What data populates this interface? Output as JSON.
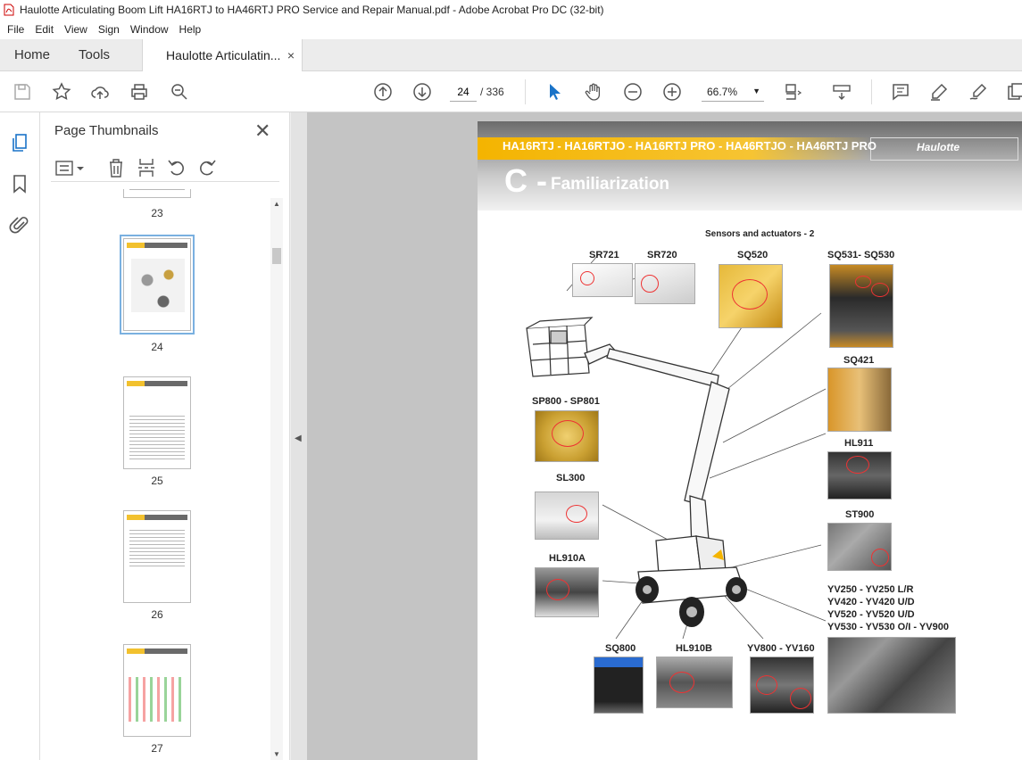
{
  "window": {
    "title": "Haulotte Articulating Boom Lift HA16RTJ to HA46RTJ PRO Service and Repair Manual.pdf - Adobe Acrobat Pro DC (32-bit)"
  },
  "menu": [
    "File",
    "Edit",
    "View",
    "Sign",
    "Window",
    "Help"
  ],
  "tabs": {
    "home": "Home",
    "tools": "Tools",
    "doc": "Haulotte Articulatin...",
    "close": "×"
  },
  "toolbar": {
    "page_current": "24",
    "page_total": "/ 336",
    "zoom": "66.7%"
  },
  "thumbnails": {
    "title": "Page Thumbnails",
    "pages": [
      {
        "label": "23"
      },
      {
        "label": "24",
        "selected": true
      },
      {
        "label": "25"
      },
      {
        "label": "26"
      },
      {
        "label": "27"
      }
    ]
  },
  "page": {
    "models": "HA16RTJ - HA16RTJO - HA16RTJ PRO - HA46RTJO - HA46RTJ PRO",
    "logo": "Haulotte",
    "chapter_letter": "C -",
    "chapter_title": "Familiarization",
    "section_title": "Sensors and actuators - 2",
    "labels": {
      "sr721": "SR721",
      "sr720": "SR720",
      "sq520": "SQ520",
      "sq531": "SQ531- SQ530",
      "sq421": "SQ421",
      "sp800": "SP800 - SP801",
      "hl911": "HL911",
      "sl300": "SL300",
      "st900": "ST900",
      "hl910a": "HL910A",
      "yv1": "YV250 - YV250 L/R",
      "yv2": "YV420 - YV420 U/D",
      "yv3": "YV520 - YV520 U/D",
      "yv4": "YV530 - YV530 O/I - YV900",
      "sq800": "SQ800",
      "hl910b": "HL910B",
      "yv800": "YV800 - YV160"
    }
  },
  "colors": {
    "accent_yellow": "#f4b400",
    "ring_red": "#e33333",
    "select_blue": "#7ab0e0"
  }
}
